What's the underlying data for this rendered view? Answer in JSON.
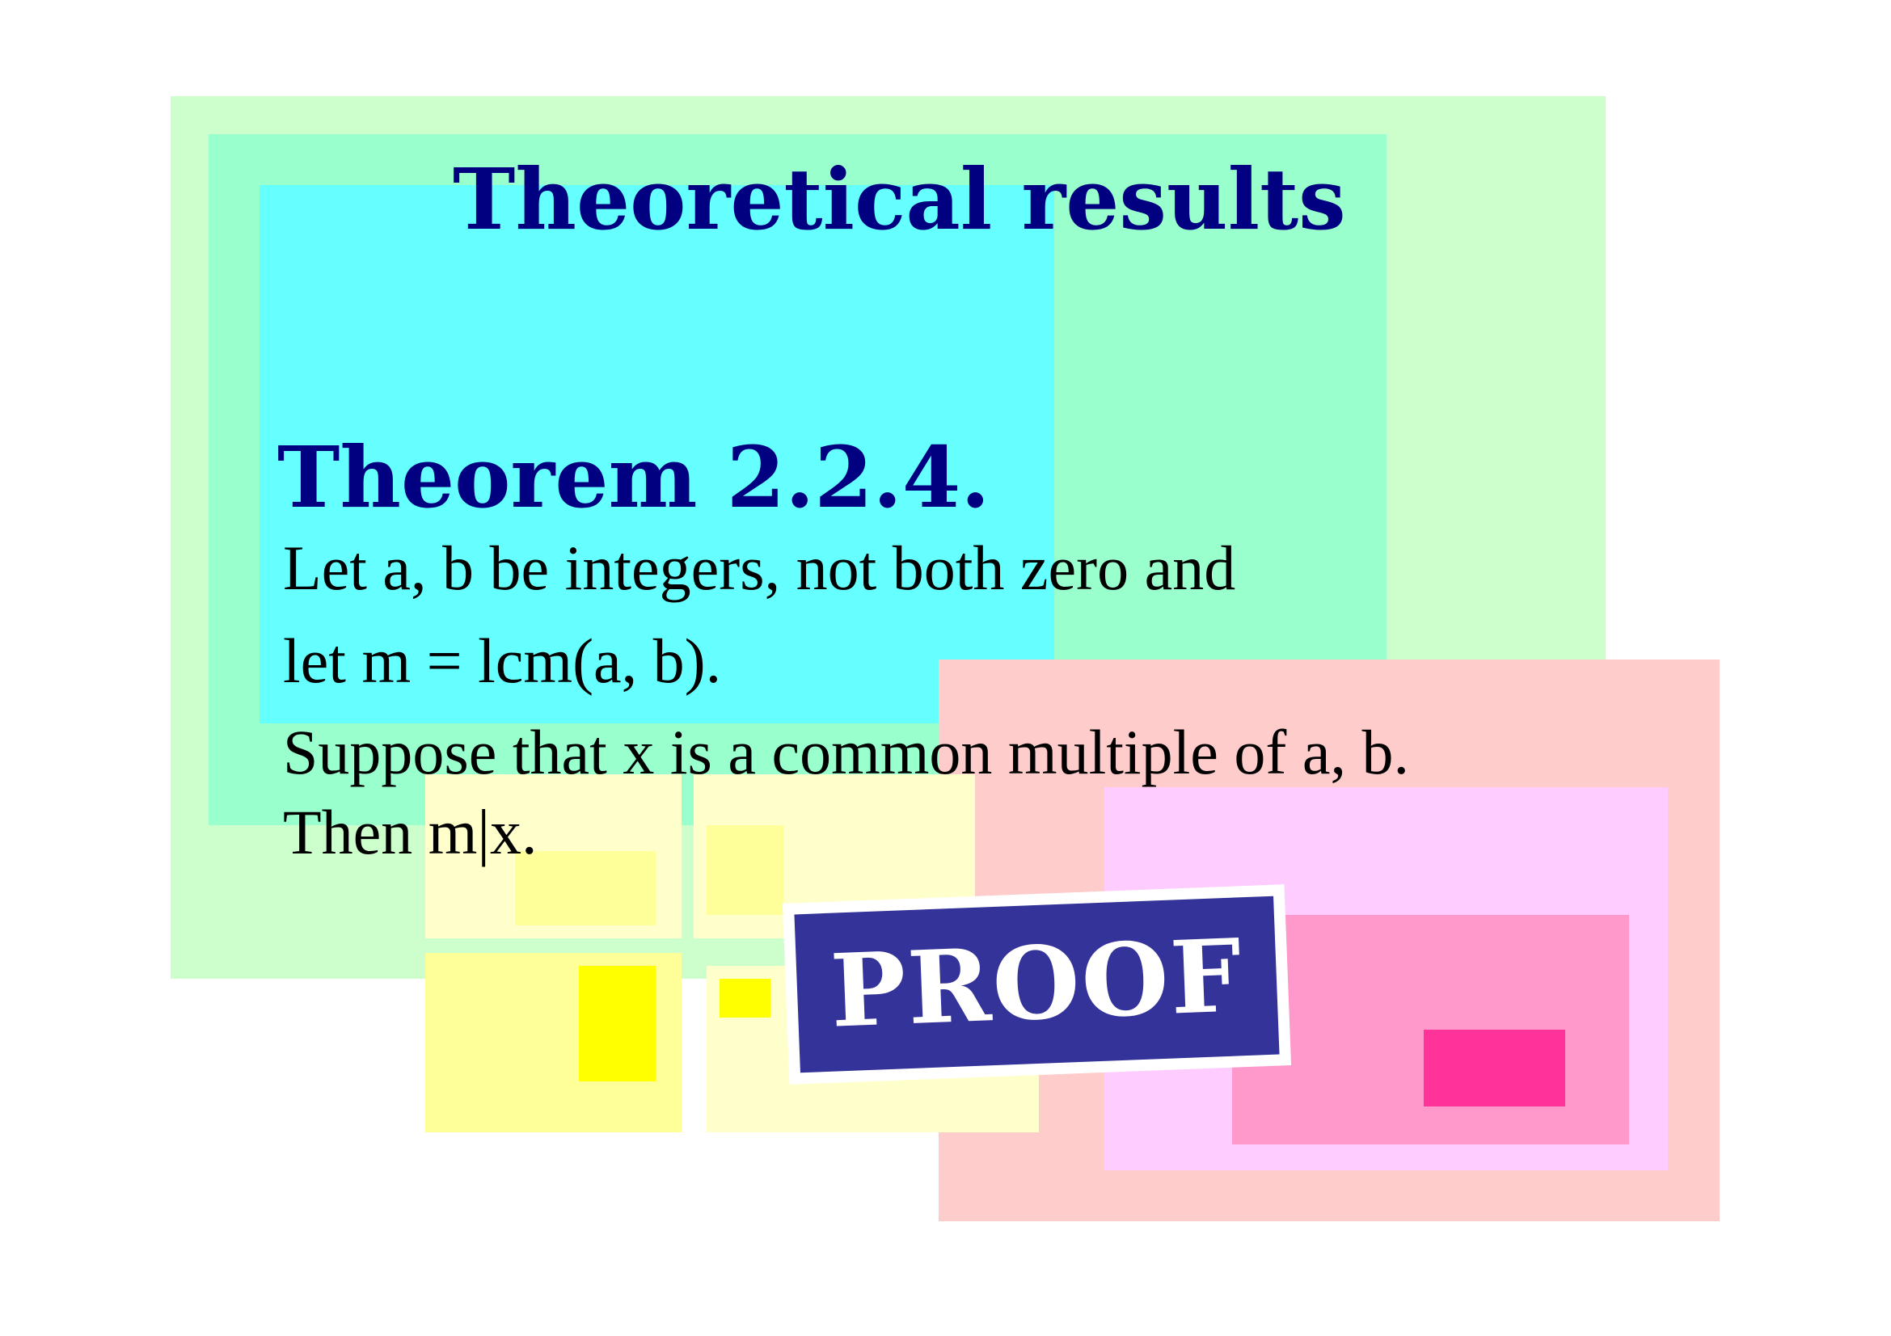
{
  "slide": {
    "title": "Theoretical results",
    "theorem": {
      "heading": "Theorem 2.2.4.",
      "lines": [
        "Let a, b be integers, not both zero and",
        "let m = lcm(a, b).",
        "Suppose that x is a common multiple of a, b.",
        "Then m|x."
      ]
    },
    "proof_button": {
      "label": "PROOF"
    }
  },
  "colors": {
    "heading": "#000080",
    "body_text": "#000000",
    "proof_background": "#333399",
    "green_light": "#ccffcc",
    "green_mid": "#99ffcc",
    "cyan": "#66ffff",
    "pink_light": "#ffcccc",
    "pink_lilac": "#ffccff",
    "pink_mid": "#ff99cc",
    "pink_strong": "#ff3399",
    "yellow_pale": "#ffffcc",
    "yellow_light": "#ffff99",
    "yellow_strong": "#ffff00"
  }
}
